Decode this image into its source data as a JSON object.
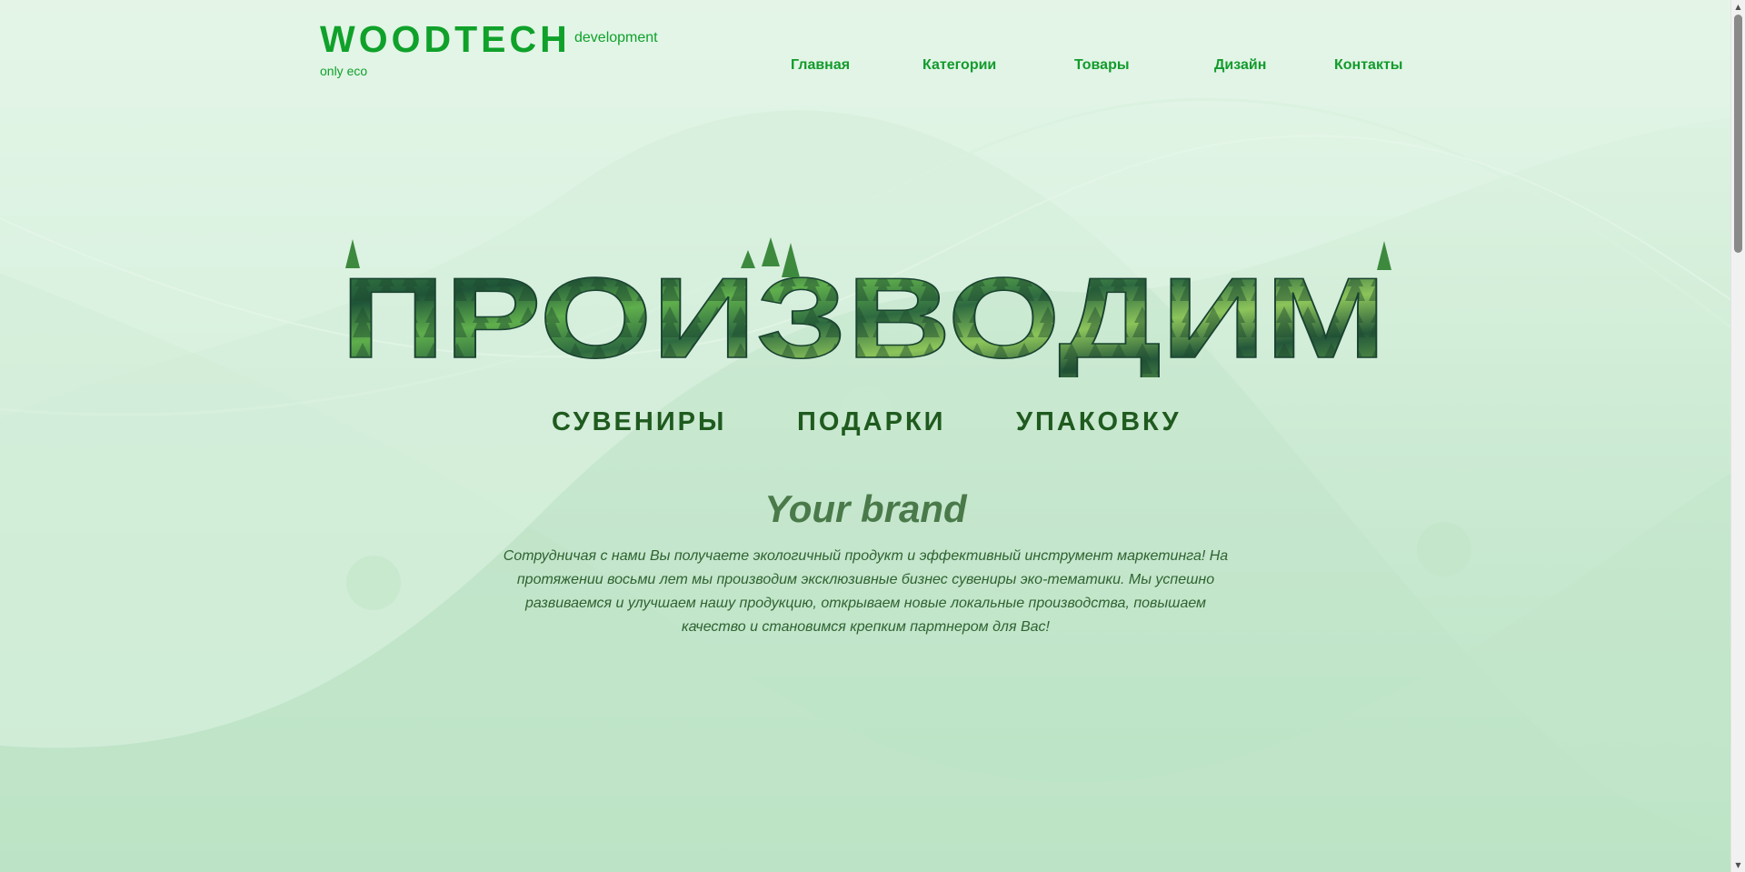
{
  "header": {
    "logo_title": "WOODTECH",
    "logo_subtitle": "development",
    "logo_tagline": "only eco"
  },
  "nav": {
    "items": [
      {
        "label": "Главная"
      },
      {
        "label": "Категории"
      },
      {
        "label": "Товары"
      },
      {
        "label": "Дизайн"
      },
      {
        "label": "Контакты"
      }
    ]
  },
  "hero": {
    "headline": "ПРОИЗВОДИМ",
    "products": [
      {
        "label": "СУВЕНИРЫ"
      },
      {
        "label": "ПОДАРКИ"
      },
      {
        "label": "УПАКОВКУ"
      }
    ],
    "brand": "Your brand",
    "description": "Сотрудничая с нами Вы получаете экологичный продукт и эффективный инструмент маркетинга! На протяжении восьми лет мы производим эксклюзивные бизнес сувениры эко-тематики. Мы успешно развиваемся и улучшаем нашу продукцию, открываем новые локальные производства, повышаем качество и становимся крепким партнером для Вас!"
  },
  "colors": {
    "accent": "#10a12a",
    "background": "#d4efd9",
    "product_text": "#1f5a1e",
    "brand_text": "#4a7a4a",
    "desc_text": "#2f6230"
  }
}
